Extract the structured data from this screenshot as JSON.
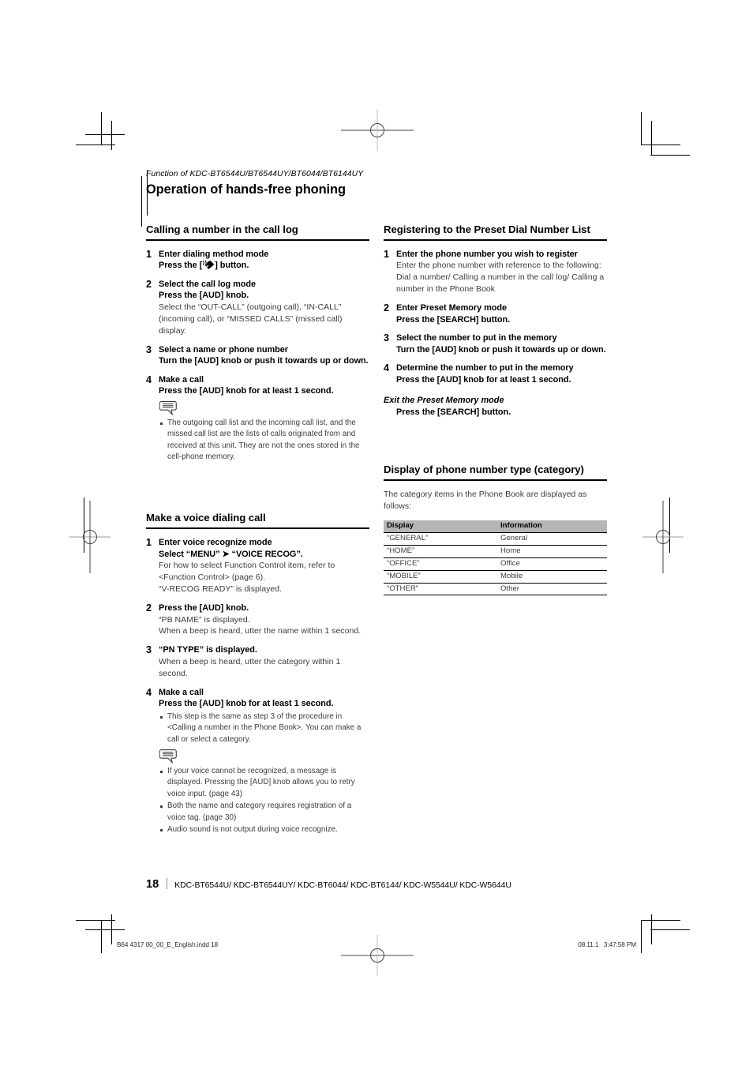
{
  "document": {
    "kicker": "Function of KDC-BT6544U/BT6544UY/BT6044/BT6144UY",
    "title": "Operation of hands-free phoning"
  },
  "left_column": {
    "sections": [
      {
        "heading": "Calling a number in the call log",
        "steps": [
          {
            "num": "1",
            "bold": "Enter dialing method mode",
            "bold2_pre": "Press the [",
            "bold2_post": "] button.",
            "icon": "phone-call-icon"
          },
          {
            "num": "2",
            "bold": "Select the call log mode",
            "bold2": "Press the [AUD] knob.",
            "body": "Select the “OUT-CALL” (outgoing call), “IN-CALL” (incoming call), or “MISSED CALLS” (missed call) display."
          },
          {
            "num": "3",
            "bold": "Select a name or phone number",
            "bold2": "Turn the [AUD] knob or push it towards up or down."
          },
          {
            "num": "4",
            "bold": "Make a call",
            "bold2": "Press the [AUD] knob for at least 1 second."
          }
        ],
        "note_bullets": [
          "The outgoing call list and the incoming call list, and the missed call list are the lists of calls originated from and received at this unit. They are not the ones stored in the cell-phone memory."
        ]
      },
      {
        "heading": "Make a voice dialing call",
        "steps": [
          {
            "num": "1",
            "bold": "Enter voice recognize mode",
            "bold2": "Select “MENU” ➤ “VOICE RECOG”.",
            "body": "For how to select Function Control item, refer to <Function Control> (page 6).\n“V-RECOG READY” is displayed."
          },
          {
            "num": "2",
            "bold": "Press the [AUD] knob.",
            "body": "“PB NAME” is displayed.\nWhen a beep is heard, utter the name within 1 second."
          },
          {
            "num": "3",
            "bold": "“PN TYPE” is displayed.",
            "body": "When a beep is heard, utter the category within 1 second."
          },
          {
            "num": "4",
            "bold": "Make a call",
            "bold2": "Press the [AUD] knob for at least 1 second.",
            "bullets": [
              "This step is the same as step 3 of the procedure in <Calling a number in the Phone Book>. You can make a call or select a category."
            ]
          }
        ],
        "note_bullets": [
          "If your voice cannot be recognized, a message is displayed. Pressing the [AUD] knob allows you to retry voice input. (page 43)",
          "Both the name and category requires registration of a voice tag. (page 30)",
          "Audio sound is not output during voice recognize."
        ]
      }
    ]
  },
  "right_column": {
    "sections": [
      {
        "heading": "Registering to the Preset Dial Number List",
        "steps": [
          {
            "num": "1",
            "bold": "Enter the phone number you wish to register",
            "body": "Enter the phone number with reference to the following:\nDial a number/ Calling a number in the call log/ Calling a number in the Phone Book"
          },
          {
            "num": "2",
            "bold": "Enter Preset Memory mode",
            "bold2": "Press the [SEARCH] button."
          },
          {
            "num": "3",
            "bold": "Select the number to put in the memory",
            "bold2": "Turn the [AUD] knob or push it towards up or down."
          },
          {
            "num": "4",
            "bold": "Determine the number to put in the memory",
            "bold2": "Press the [AUD] knob for at least 1 second."
          }
        ],
        "exit": {
          "title": "Exit the Preset Memory mode",
          "action": "Press the [SEARCH] button."
        }
      },
      {
        "heading": "Display of phone number type (category)",
        "intro": "The category items in the Phone Book are displayed as follows:",
        "table": {
          "headers": [
            "Display",
            "Information"
          ],
          "rows": [
            [
              "“GENERAL”",
              "General"
            ],
            [
              "“HOME”",
              "Home"
            ],
            [
              "“OFFICE”",
              "Office"
            ],
            [
              "“MOBILE”",
              "Mobile"
            ],
            [
              "“OTHER”",
              "Other"
            ]
          ]
        }
      }
    ]
  },
  "footer": {
    "page_number": "18",
    "models": "KDC-BT6544U/ KDC-BT6544UY/ KDC-BT6044/ KDC-BT6144/ KDC-W5544U/ KDC-W5644U"
  },
  "imprint": {
    "file": "B64 4317 00_00_E_English.indd   18",
    "timestamp": "08.11.1   3:47:58 PM"
  },
  "colors": {
    "table_header_bg": "#b5b5b5",
    "body_text": "#3d3d3d",
    "rule": "#000000"
  }
}
